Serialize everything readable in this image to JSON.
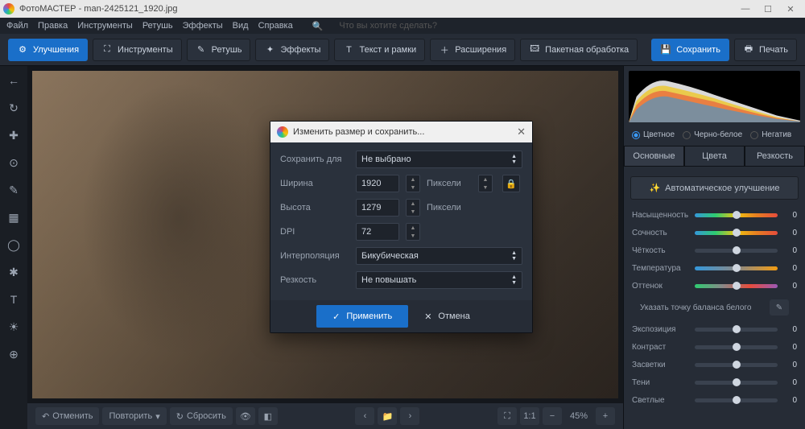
{
  "titlebar": {
    "app": "ФотоМАСТЕР",
    "file": "man-2425121_1920.jpg"
  },
  "menu": [
    "Файл",
    "Правка",
    "Инструменты",
    "Ретушь",
    "Эффекты",
    "Вид",
    "Справка"
  ],
  "search_hint": "Что вы хотите сделать?",
  "toolbar": {
    "enhance": "Улучшения",
    "tools": "Инструменты",
    "retouch": "Ретушь",
    "effects": "Эффекты",
    "text": "Текст и рамки",
    "ext": "Расширения",
    "batch": "Пакетная обработка",
    "save": "Сохранить",
    "print": "Печать"
  },
  "bottombar": {
    "undo": "Отменить",
    "redo": "Повторить",
    "reset": "Сбросить",
    "zoom": "45%",
    "ratio": "1:1"
  },
  "radios": {
    "color": "Цветное",
    "bw": "Черно-белое",
    "neg": "Негатив"
  },
  "tabs": {
    "main": "Основные",
    "colors": "Цвета",
    "sharp": "Резкость"
  },
  "auto": "Автоматическое улучшение",
  "sliders": [
    {
      "label": "Насыщенность",
      "value": "0",
      "style": "rainbow"
    },
    {
      "label": "Сочность",
      "value": "0",
      "style": "rainbow"
    },
    {
      "label": "Чёткость",
      "value": "0",
      "style": ""
    },
    {
      "label": "Температура",
      "value": "0",
      "style": "temp"
    },
    {
      "label": "Оттенок",
      "value": "0",
      "style": "tint"
    }
  ],
  "wb": "Указать точку баланса белого",
  "sliders2": [
    {
      "label": "Экспозиция",
      "value": "0"
    },
    {
      "label": "Контраст",
      "value": "0"
    },
    {
      "label": "Засветки",
      "value": "0"
    },
    {
      "label": "Тени",
      "value": "0"
    },
    {
      "label": "Светлые",
      "value": "0"
    }
  ],
  "dialog": {
    "title": "Изменить размер и сохранить...",
    "save_for": "Сохранить для",
    "save_for_val": "Не выбрано",
    "width": "Ширина",
    "width_val": "1920",
    "width_unit": "Пиксели",
    "height": "Высота",
    "height_val": "1279",
    "height_unit": "Пиксели",
    "dpi": "DPI",
    "dpi_val": "72",
    "interp": "Интерполяция",
    "interp_val": "Бикубическая",
    "sharp": "Резкость",
    "sharp_val": "Не повышать",
    "apply": "Применить",
    "cancel": "Отмена"
  }
}
